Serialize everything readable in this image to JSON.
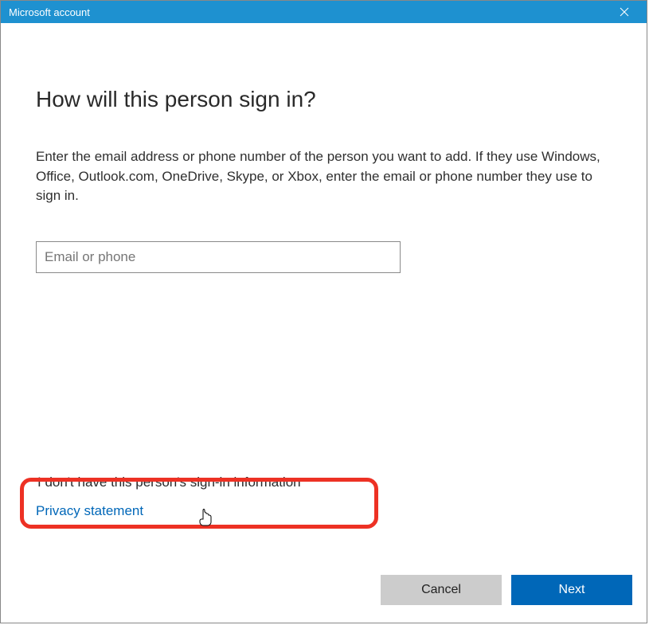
{
  "titlebar": {
    "title": "Microsoft account"
  },
  "main": {
    "heading": "How will this person sign in?",
    "description": "Enter the email address or phone number of the person you want to add. If they use Windows, Office, Outlook.com, OneDrive, Skype, or Xbox, enter the email or phone number they use to sign in.",
    "input_placeholder": "Email or phone",
    "input_value": ""
  },
  "links": {
    "no_info": "I don't have this person's sign-in information",
    "privacy": "Privacy statement"
  },
  "buttons": {
    "cancel": "Cancel",
    "next": "Next"
  },
  "colors": {
    "titlebar_bg": "#1e91d0",
    "primary_button": "#0067b8",
    "highlight": "#ed3124"
  }
}
